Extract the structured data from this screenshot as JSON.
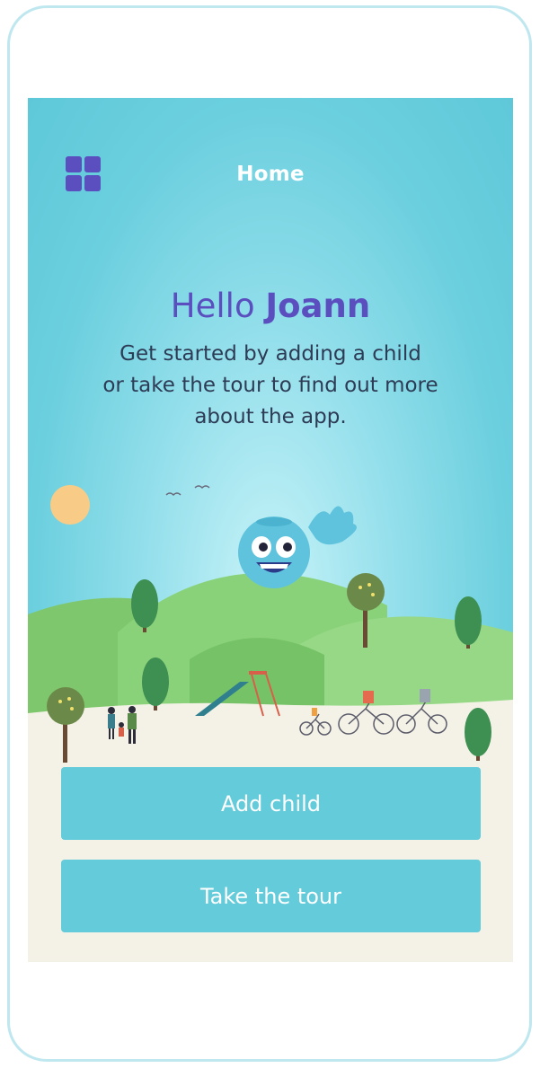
{
  "header": {
    "title": "Home",
    "menu_icon": "grid-menu-icon"
  },
  "greeting": {
    "hello": "Hello",
    "name": "Joann"
  },
  "intro": {
    "line1": "Get started by adding a child",
    "line2": "or take the tour to find out more",
    "line3": "about the app."
  },
  "actions": {
    "add_child": "Add child",
    "take_tour": "Take the tour"
  },
  "colors": {
    "accent": "#5b4fbf",
    "button": "#64cbda",
    "sky": "#6bcfde",
    "hills": "#8fd07c",
    "ground": "#f4f2e6"
  }
}
